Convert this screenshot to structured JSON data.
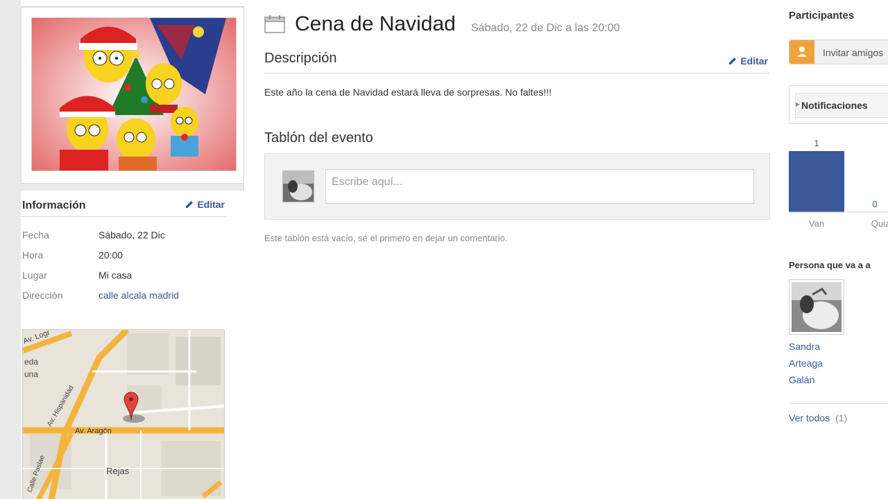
{
  "event": {
    "title": "Cena de Navidad",
    "date": "Sábado, 22 de Dic a las 20:00"
  },
  "description": {
    "heading": "Descripción",
    "edit_label": "Editar",
    "text": "Este año la cena de Navidad estará lleva de sorpresas. No faltes!!!"
  },
  "wall": {
    "heading": "Tablón del evento",
    "placeholder": "Escribe aquí...",
    "empty_text": "Este tablón está vacío, sé el primero en dejar un comentario."
  },
  "info": {
    "heading": "Información",
    "edit_label": "Editar",
    "rows": [
      {
        "key": "Fecha",
        "value": "Sábado, 22 Dic"
      },
      {
        "key": "Hora",
        "value": "20:00"
      },
      {
        "key": "Lugar",
        "value": "Mi casa"
      },
      {
        "key": "Dirección",
        "value": "calle alcala madrid"
      }
    ]
  },
  "map": {
    "labels": [
      "Av. Logr",
      "eda",
      "una",
      "Av. Hispanidad",
      "Av. Aragón",
      "Calle Paslae",
      "Rejas"
    ]
  },
  "participants": {
    "heading": "Participantes",
    "invite_label": "Invitar amigos",
    "notifications_label": "Notificaciones",
    "chart": {
      "categories": [
        "Van",
        "Quizás v"
      ],
      "values": [
        1,
        0
      ]
    },
    "attending_heading": "Persona que va a a",
    "attendee_name_lines": [
      "Sandra",
      "Arteaga",
      "Galán"
    ],
    "see_all_label": "Ver todos",
    "see_all_count": "(1)"
  },
  "colors": {
    "link": "#3b5998",
    "bar": "#3b5998",
    "invite_icon": "#f0a33d",
    "map_road": "#f3b33d"
  },
  "icons": [
    "calendar-icon",
    "pencil-icon",
    "user-icon",
    "caret-right-icon",
    "map-pin-icon"
  ]
}
